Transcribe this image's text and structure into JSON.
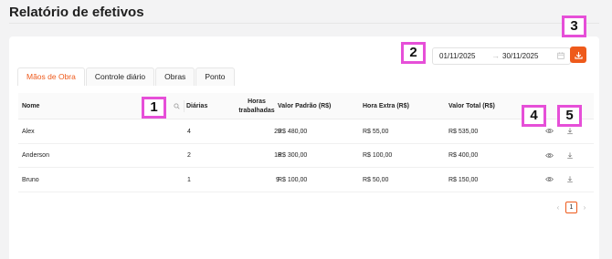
{
  "page": {
    "title": "Relatório de efetivos"
  },
  "filters": {
    "start_date": "01/11/2025",
    "end_date": "30/11/2025",
    "range_separator": "→"
  },
  "tabs": [
    {
      "label": "Mãos de Obra",
      "active": true
    },
    {
      "label": "Controle diário",
      "active": false
    },
    {
      "label": "Obras",
      "active": false
    },
    {
      "label": "Ponto",
      "active": false
    }
  ],
  "table": {
    "headers": {
      "nome": "Nome",
      "diarias": "Diárias",
      "horas": "Horas trabalhadas",
      "valor_padrao": "Valor Padrão (R$)",
      "hora_extra": "Hora Extra (R$)",
      "valor_total": "Valor Total (R$)"
    },
    "rows": [
      {
        "nome": "Alex",
        "diarias": "4",
        "horas": "29",
        "valor_padrao": "R$ 480,00",
        "hora_extra": "R$ 55,00",
        "valor_total": "R$ 535,00"
      },
      {
        "nome": "Anderson",
        "diarias": "2",
        "horas": "18",
        "valor_padrao": "R$ 300,00",
        "hora_extra": "R$ 100,00",
        "valor_total": "R$ 400,00"
      },
      {
        "nome": "Bruno",
        "diarias": "1",
        "horas": "9",
        "valor_padrao": "R$ 100,00",
        "hora_extra": "R$ 50,00",
        "valor_total": "R$ 150,00"
      }
    ]
  },
  "pagination": {
    "current_page": "1",
    "prev": "‹",
    "next": "›"
  },
  "markers": [
    "1",
    "2",
    "3",
    "4",
    "5"
  ],
  "icons": {
    "download": "download-icon",
    "calendar": "calendar-icon",
    "search": "search-icon",
    "view": "eye-icon",
    "row_download": "download-icon"
  },
  "colors": {
    "accent": "#ee5a1b",
    "marker": "#e64fd8"
  }
}
